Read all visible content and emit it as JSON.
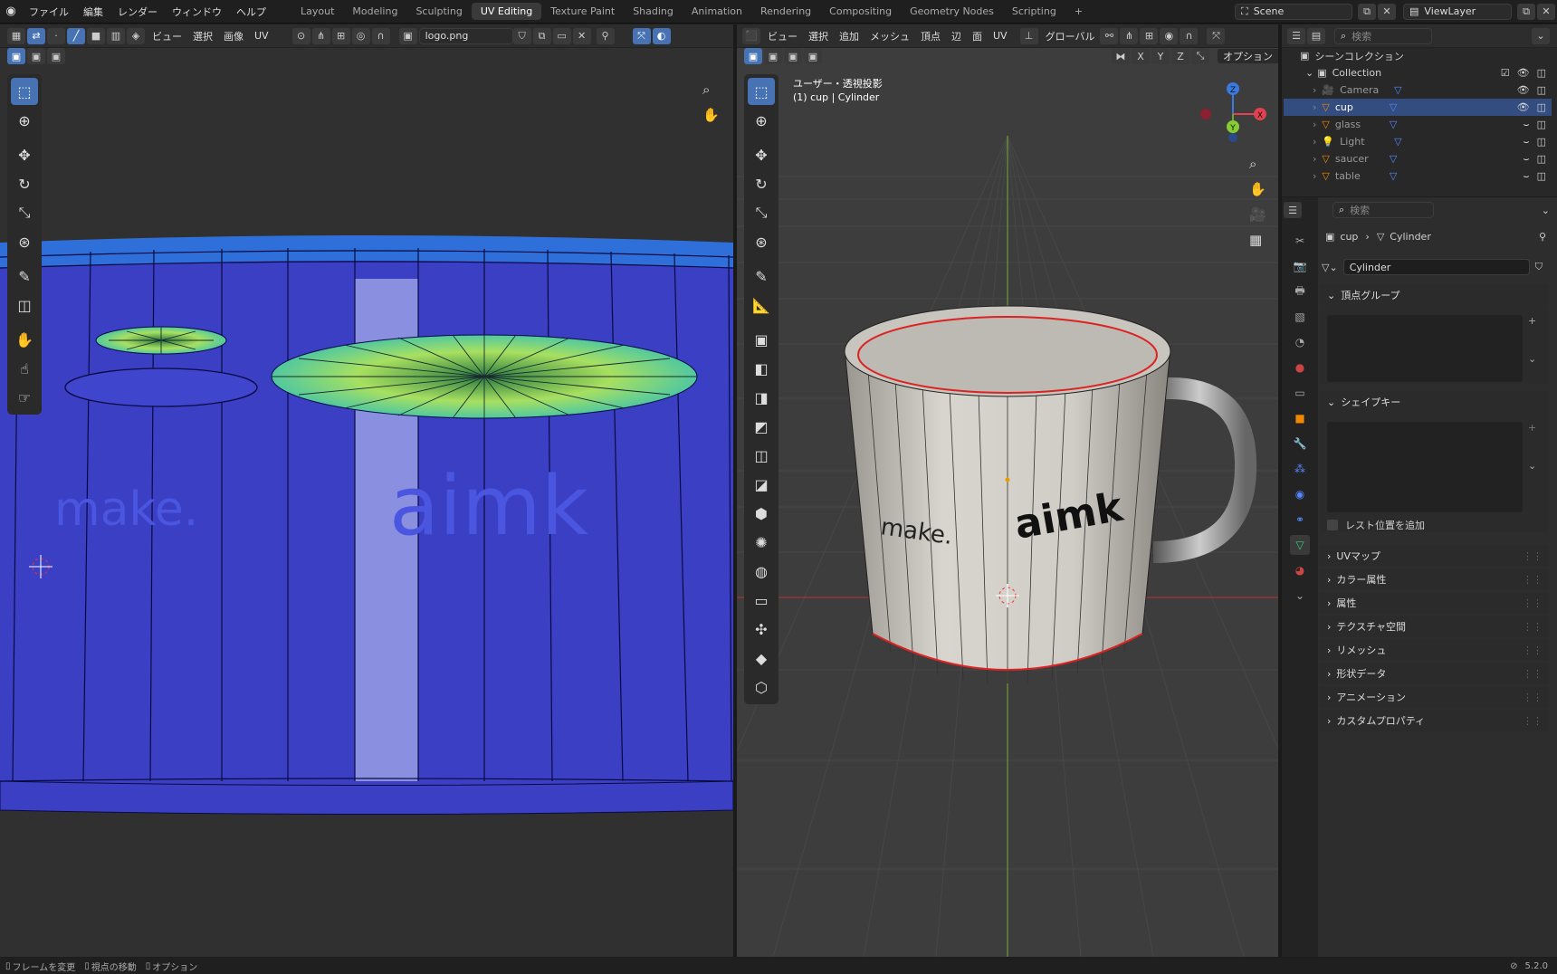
{
  "topbar": {
    "menus": [
      "ファイル",
      "編集",
      "レンダー",
      "ウィンドウ",
      "ヘルプ"
    ],
    "workspaces": [
      "Layout",
      "Modeling",
      "Sculpting",
      "UV Editing",
      "Texture Paint",
      "Shading",
      "Animation",
      "Rendering",
      "Compositing",
      "Geometry Nodes",
      "Scripting"
    ],
    "active_workspace": "UV Editing",
    "add_tab": "+",
    "scene": "Scene",
    "view_layer": "ViewLayer"
  },
  "uv_editor": {
    "menus": [
      "ビュー",
      "選択",
      "画像",
      "UV"
    ],
    "image_name": "logo.png"
  },
  "viewport": {
    "menus": [
      "ビュー",
      "選択",
      "追加",
      "メッシュ",
      "頂点",
      "辺",
      "面",
      "UV"
    ],
    "orientation": "グローバル",
    "options_label": "オプション",
    "axes": [
      "X",
      "Y",
      "Z"
    ],
    "view_name": "ユーザー・透視投影",
    "object_info": "(1) cup | Cylinder",
    "gizmo": {
      "x": "X",
      "y": "Y",
      "z": "Z"
    },
    "mug_text_left": "make.",
    "mug_text_right": "aimk"
  },
  "outliner": {
    "search_placeholder": "検索",
    "scene_collection": "シーンコレクション",
    "collection": "Collection",
    "items": [
      {
        "name": "Camera",
        "selected": false,
        "visible": true
      },
      {
        "name": "cup",
        "selected": true,
        "visible": true
      },
      {
        "name": "glass",
        "selected": false,
        "visible": false
      },
      {
        "name": "Light",
        "selected": false,
        "visible": false
      },
      {
        "name": "saucer",
        "selected": false,
        "visible": false
      },
      {
        "name": "table",
        "selected": false,
        "visible": false
      }
    ]
  },
  "properties": {
    "search_placeholder": "検索",
    "breadcrumb_object": "cup",
    "breadcrumb_data": "Cylinder",
    "mesh_name": "Cylinder",
    "vertex_groups": "頂点グループ",
    "shape_keys": "シェイプキー",
    "relative_label": "レスト位置を追加",
    "collapsed_panels": [
      "UVマップ",
      "カラー属性",
      "属性",
      "テクスチャ空間",
      "リメッシュ",
      "形状データ",
      "アニメーション",
      "カスタムプロパティ"
    ]
  },
  "statusbar": {
    "left": [
      "フレームを変更",
      "視点の移動",
      "オプション"
    ],
    "version": "5.2.0"
  },
  "colors": {
    "accent": "#4772b3",
    "uv_bg": "#3a3fc4",
    "uv_band": "#2f6fd9",
    "selected_row": "#334d80",
    "viewport_bg": "#3d3d3d"
  }
}
